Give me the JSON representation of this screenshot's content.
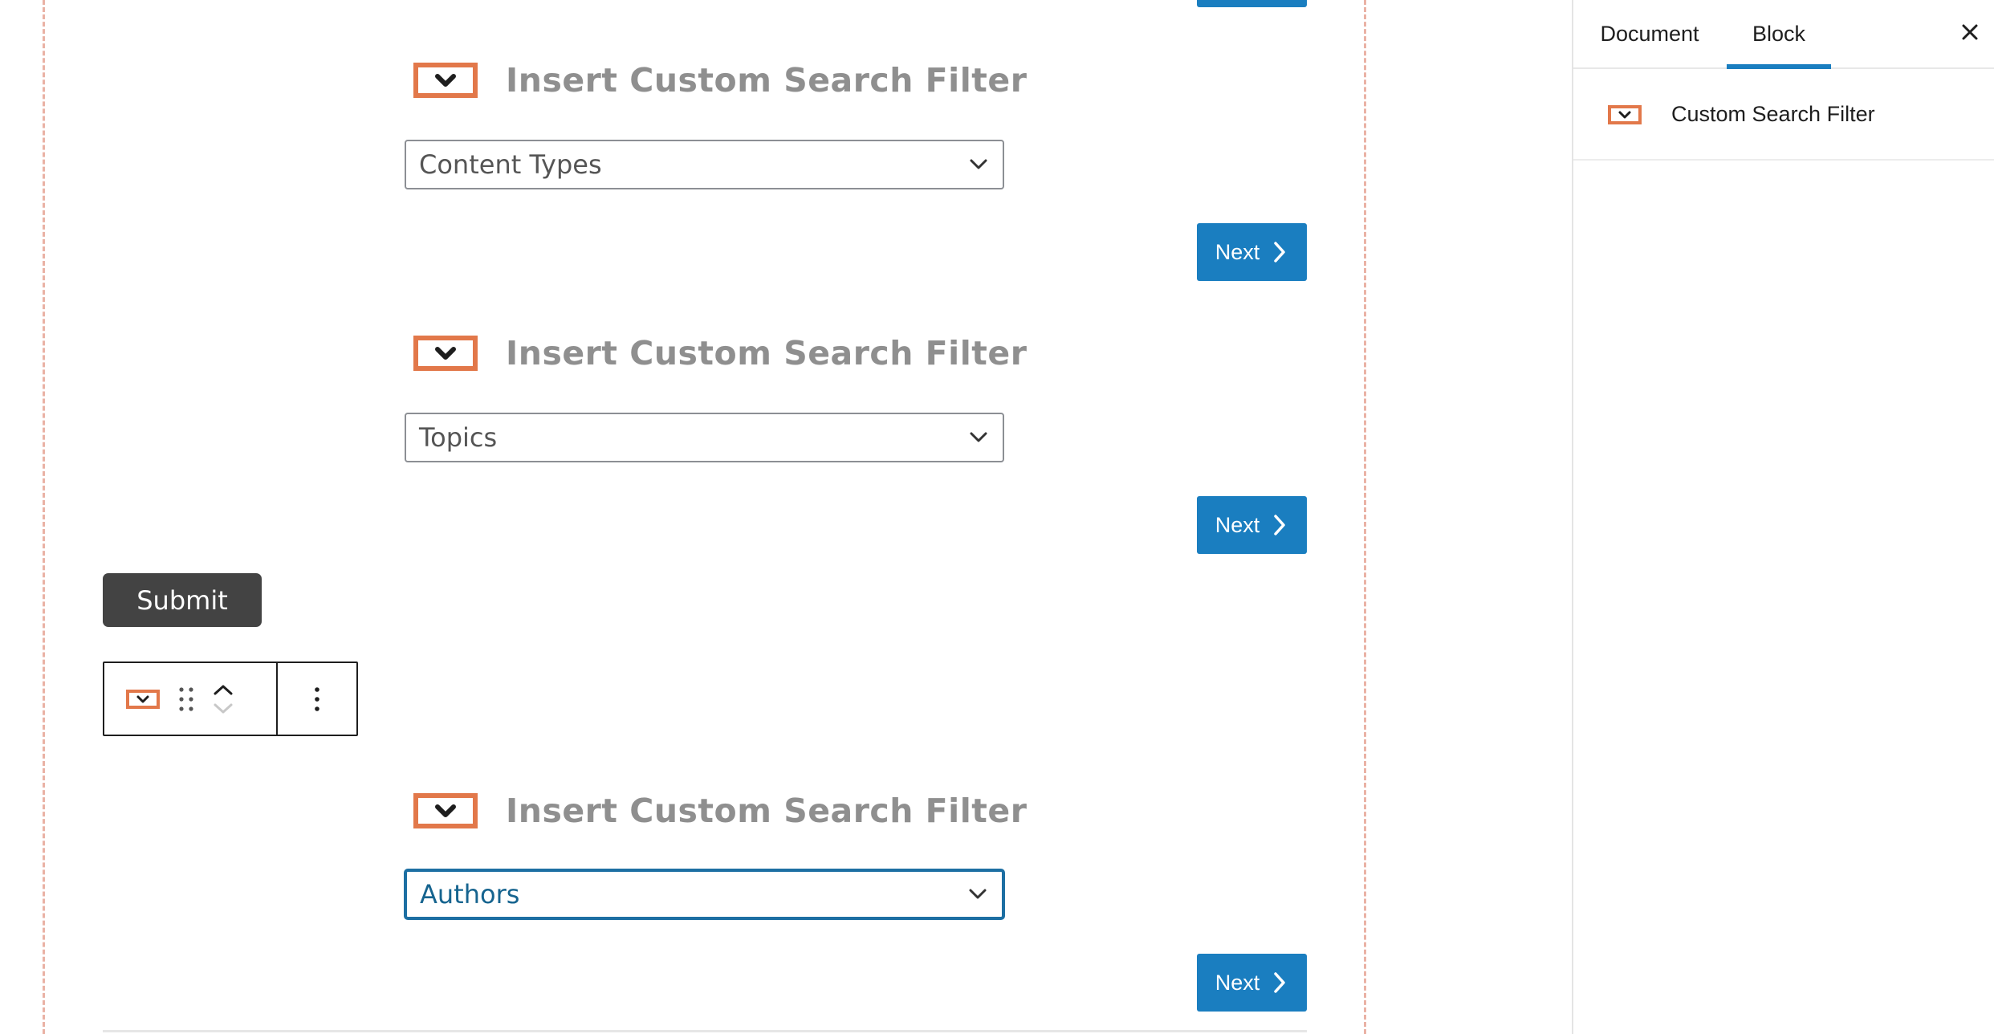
{
  "colors": {
    "accent": "#1a7ec0",
    "icon_orange": "#e2784a",
    "heading_gray": "#8f8f8f",
    "submit_bg": "#434343",
    "focus_border": "#1d6fa3"
  },
  "editor": {
    "filters": [
      {
        "heading": "Insert Custom Search Filter",
        "icon": "custom-search-filter-icon",
        "select_value": "Content Types",
        "next_label": "Next"
      },
      {
        "heading": "Insert Custom Search Filter",
        "icon": "custom-search-filter-icon",
        "select_value": "Topics",
        "next_label": "Next"
      },
      {
        "heading": "Insert Custom Search Filter",
        "icon": "custom-search-filter-icon",
        "select_value": "Authors",
        "next_label": "Next",
        "focused": true
      }
    ],
    "submit_label": "Submit",
    "block_toolbar": {
      "block_icon": "custom-search-filter-icon",
      "drag_icon": "drag-handle-icon",
      "move_up_icon": "chevron-up-icon",
      "move_down_icon": "chevron-down-icon",
      "more_icon": "more-vertical-icon"
    }
  },
  "sidebar": {
    "tabs": [
      {
        "label": "Document",
        "active": false
      },
      {
        "label": "Block",
        "active": true
      }
    ],
    "close_icon": "close-icon",
    "block_card": {
      "icon": "custom-search-filter-icon",
      "title": "Custom Search Filter"
    }
  }
}
